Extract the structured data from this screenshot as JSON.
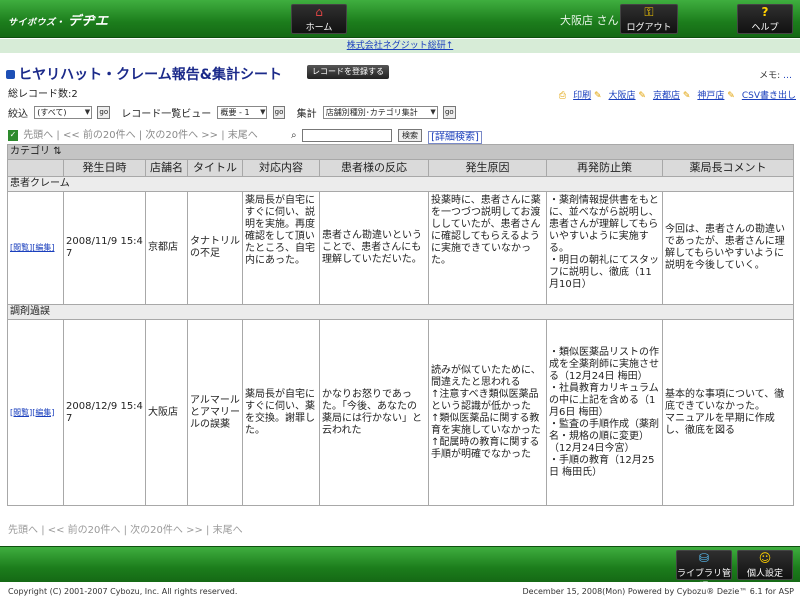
{
  "header": {
    "logo_small": "サイボウズ・",
    "logo_main": "デヂエ",
    "home_label": "ホーム",
    "user": "大阪店 さん",
    "logout_label": "ログアウト",
    "help_label": "ヘルプ",
    "company_link": "株式会社ネグジット総研↑"
  },
  "title": {
    "text": "ヒヤリハット・クレーム報告&集計シート",
    "register_button": "レコードを登録する",
    "memo_label": "メモ:",
    "memo_link": "…"
  },
  "record_count": "総レコード数:2",
  "links": {
    "print": "印刷",
    "osaka": "大阪店",
    "kyoto": "京都店",
    "kobe": "神戸店",
    "csv": "CSV書き出し"
  },
  "filter": {
    "narrow_label": "絞込",
    "narrow_value": "(すべて)",
    "go": "go",
    "view_label": "レコード一覧ビュー",
    "view_value": "概要 - 1",
    "sum_label": "集計",
    "sum_value": "店舗別種別･カテゴリ集計"
  },
  "nav": {
    "first": "先頭へ",
    "prev": "<< 前の20件へ",
    "next": "次の20件へ >>",
    "last": "末尾へ",
    "search_button": "検索",
    "detail": "[詳細検索]",
    "sep": "|"
  },
  "table": {
    "category_header": "カテゴリ",
    "columns": [
      "発生日時",
      "店舗名",
      "タイトル",
      "対応内容",
      "患者様の反応",
      "発生原因",
      "再発防止策",
      "薬局長コメント"
    ],
    "groups": [
      {
        "name": "患者クレーム",
        "row": {
          "view": "[閲覧]",
          "edit": "[編集]",
          "datetime": "2008/11/9 15:47",
          "store": "京都店",
          "title": "タナトリルの不足",
          "response": "薬局長が自宅にすぐに伺い、説明を実施。再度確認をして頂いたところ、自宅内にあった。",
          "reaction": "患者さん勘違いということで、患者さんにも理解していただいた。",
          "cause": "投薬時に、患者さんに薬を一つづつ説明してお渡ししていたが、患者さんに確認してもらえるように実施できていなかった。",
          "prevention": "・薬剤情報提供書をもとに、並べながら説明し、患者さんが理解してもらいやすいように実施する。\n・明日の朝礼にてスタッフに説明し、徹底（11月10日）",
          "comment": "今回は、患者さんの勘違いであったが、患者さんに理解してもらいやすいように説明を今後していく。"
        }
      },
      {
        "name": "調剤過誤",
        "row": {
          "view": "[閲覧]",
          "edit": "[編集]",
          "datetime": "2008/12/9 15:47",
          "store": "大阪店",
          "title": "アルマールとアマリールの誤薬",
          "response": "薬局長が自宅にすぐに伺い、薬を交換。謝罪した。",
          "reaction": "かなりお怒りであった。「今後、あなたの薬局には行かない」と云われた",
          "cause": "読みが似ていたために、間違えたと思われる\n↑注意すべき類似医薬品という認識が低かった\n↑類似医薬品に関する教育を実施していなかった\n↑配属時の教育に関する手順が明確でなかった",
          "prevention": "・類似医薬品リストの作成を全薬剤師に実施させる（12月24日 梅田）\n・社員教育カリキュラムの中に上記を含める（1月6日 梅田）\n・監査の手順作成（薬剤名・規格の順に変更）（12月24日今宮）\n・手順の教育（12月25日 梅田氏）",
          "comment": "基本的な事項について、徹底できていなかった。\nマニュアルを早期に作成し、徹底を図る"
        }
      }
    ]
  },
  "footer": {
    "library_label": "ライブラリ管理",
    "personal_label": "個人設定",
    "copyright": "Copyright (C) 2001-2007 Cybozu, Inc. All rights reserved.",
    "date_powered": "December 15, 2008(Mon)   Powered by Cybozu® Dezie™ 6.1 for ASP"
  },
  "colors": {
    "header_green": "#1c7d1c",
    "link_blue": "#1a3fbd",
    "title_navy": "#1b2a8a"
  }
}
